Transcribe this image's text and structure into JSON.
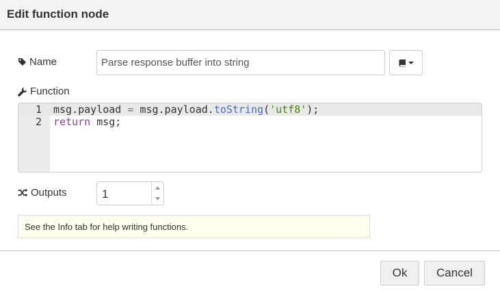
{
  "dialog": {
    "title": "Edit function node"
  },
  "name_row": {
    "label": "Name",
    "label_icon": "tag-icon",
    "value": "Parse response buffer into string",
    "library_button_icon": "book-icon"
  },
  "function_row": {
    "label": "Function",
    "label_icon": "wrench-icon",
    "lines": [
      {
        "number": "1",
        "tokens": [
          {
            "t": "msg.payload ",
            "c": ""
          },
          {
            "t": "=",
            "c": "tok-op"
          },
          {
            "t": " msg.payload.",
            "c": ""
          },
          {
            "t": "toString",
            "c": "tok-fn"
          },
          {
            "t": "(",
            "c": ""
          },
          {
            "t": "'utf8'",
            "c": "tok-str"
          },
          {
            "t": ");",
            "c": ""
          }
        ]
      },
      {
        "number": "2",
        "tokens": [
          {
            "t": "return",
            "c": "tok-kw"
          },
          {
            "t": " msg;",
            "c": ""
          }
        ]
      }
    ]
  },
  "outputs_row": {
    "label": "Outputs",
    "label_icon": "shuffle-icon",
    "value": "1"
  },
  "tip": {
    "text": "See the Info tab for help writing functions."
  },
  "buttons": {
    "ok": "Ok",
    "cancel": "Cancel"
  },
  "colors": {
    "header_bg": "#f3f3f3",
    "tip_bg": "#ffffee",
    "button_bg": "#efefef"
  }
}
